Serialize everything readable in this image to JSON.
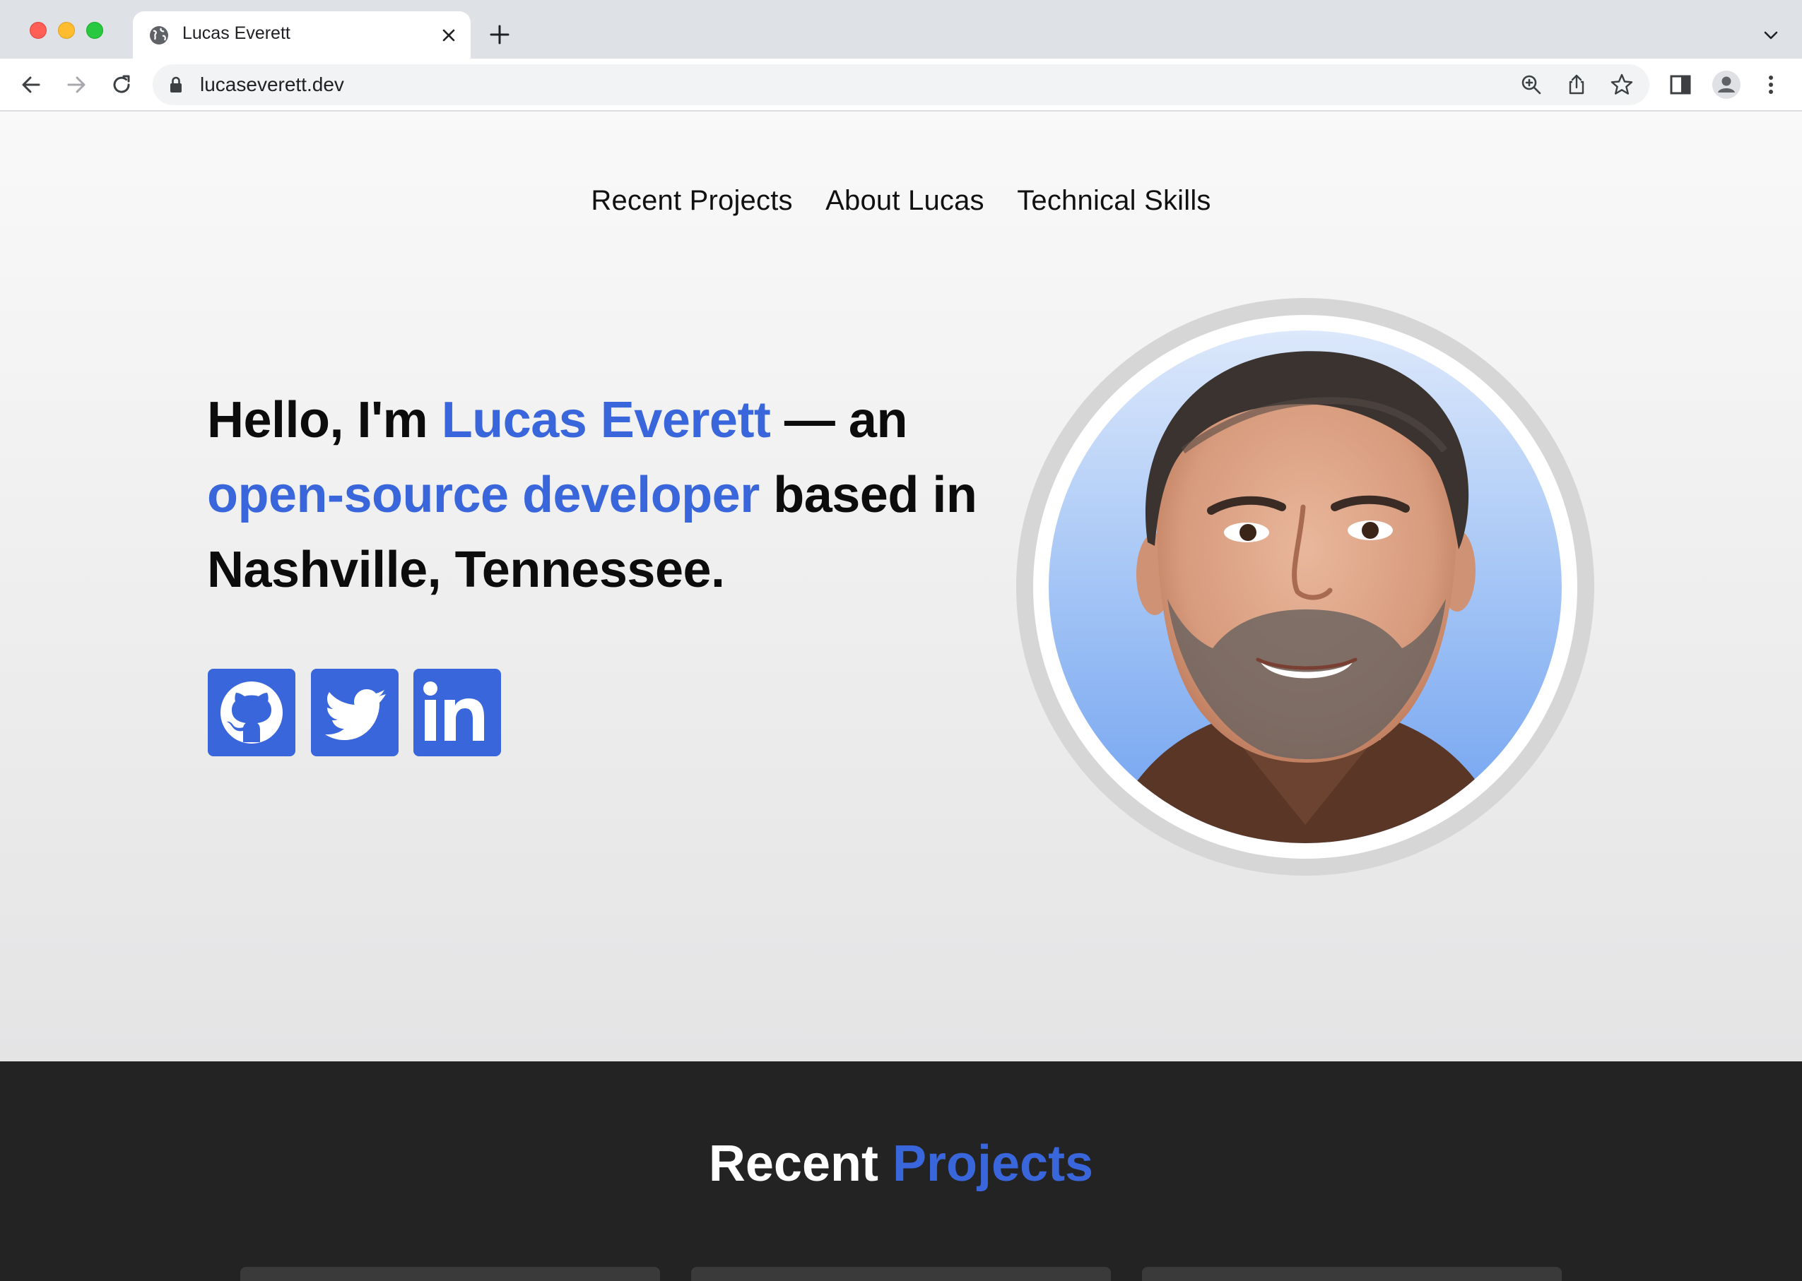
{
  "browser": {
    "tab_title": "Lucas Everett",
    "url": "lucaseverett.dev"
  },
  "nav": {
    "items": [
      "Recent Projects",
      "About Lucas",
      "Technical Skills"
    ]
  },
  "hero": {
    "part1": "Hello, I'm ",
    "name": "Lucas Everett",
    "part2": " — an ",
    "role": "open-source developer",
    "part3": " based in Nashville, Tennessee.",
    "accent_color": "#3a66db"
  },
  "social": {
    "icons": [
      "github-icon",
      "twitter-icon",
      "linkedin-icon"
    ]
  },
  "projects": {
    "title_white": "Recent ",
    "title_accent": "Projects"
  }
}
